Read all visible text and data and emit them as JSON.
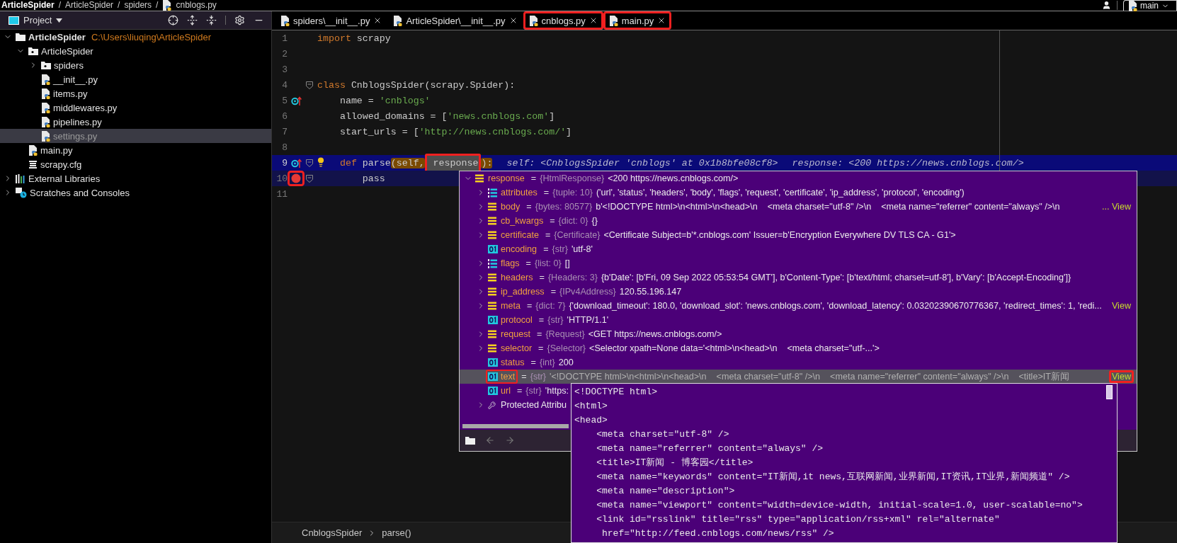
{
  "breadcrumbs": [
    {
      "kind": "item",
      "text": "ArticleSpider"
    },
    {
      "kind": "sep",
      "text": "/"
    },
    {
      "kind": "item",
      "text": "ArticleSpider"
    },
    {
      "kind": "sep",
      "text": "/"
    },
    {
      "kind": "item",
      "text": "spiders"
    },
    {
      "kind": "sep",
      "text": "/"
    },
    {
      "kind": "file",
      "text": "cnblogs.py"
    }
  ],
  "vcs": {
    "branch": "main"
  },
  "sidebar": {
    "title": "Project",
    "tree": [
      {
        "label": "ArticleSpider",
        "kind": "project",
        "path": "C:\\Users\\liuqing\\ArticleSpider",
        "expanded": true,
        "selected": false,
        "children": [
          {
            "label": "ArticleSpider",
            "kind": "package",
            "expanded": true,
            "selected": false,
            "children": [
              {
                "label": "spiders",
                "kind": "package",
                "expanded": false,
                "selected": false
              },
              {
                "label": "__init__.py",
                "kind": "python",
                "selected": false
              },
              {
                "label": "items.py",
                "kind": "python",
                "selected": false
              },
              {
                "label": "middlewares.py",
                "kind": "python",
                "selected": false
              },
              {
                "label": "pipelines.py",
                "kind": "python",
                "selected": false
              },
              {
                "label": "settings.py",
                "kind": "python",
                "selected": true
              }
            ]
          },
          {
            "label": "main.py",
            "kind": "python",
            "selected": false
          },
          {
            "label": "scrapy.cfg",
            "kind": "config",
            "selected": false
          }
        ]
      },
      {
        "label": "External Libraries",
        "kind": "libraries",
        "expanded": false,
        "selected": false
      },
      {
        "label": "Scratches and Consoles",
        "kind": "scratches",
        "expanded": false,
        "selected": false
      }
    ]
  },
  "tabs": [
    {
      "label": "spiders\\__init__.py",
      "selected": false,
      "marked": false
    },
    {
      "label": "ArticleSpider\\__init__.py",
      "selected": false,
      "marked": false
    },
    {
      "label": "cnblogs.py",
      "selected": true,
      "marked": true
    },
    {
      "label": "main.py",
      "selected": false,
      "marked": true
    }
  ],
  "editor": {
    "lines": [
      {
        "number": "1",
        "current": false,
        "breakpoint": false,
        "override": false,
        "fold": false,
        "tokens": [
          {
            "kind": "keyword",
            "text": "import"
          },
          {
            "kind": "plain",
            "text": " scrapy"
          }
        ]
      },
      {
        "number": "2",
        "current": false,
        "breakpoint": false,
        "override": false,
        "fold": false
      },
      {
        "number": "3",
        "current": false,
        "breakpoint": false,
        "override": false,
        "fold": false
      },
      {
        "number": "4",
        "current": false,
        "breakpoint": false,
        "override": false,
        "fold": true,
        "tokens": [
          {
            "kind": "keyword",
            "text": "class"
          },
          {
            "kind": "plain",
            "text": " CnblogsSpider(scrapy.Spider):"
          }
        ]
      },
      {
        "number": "5",
        "current": false,
        "breakpoint": false,
        "override": true,
        "fold": false,
        "tokens": [
          {
            "kind": "plain",
            "text": "    name = "
          },
          {
            "kind": "string",
            "text": "'cnblogs'"
          }
        ]
      },
      {
        "number": "6",
        "current": false,
        "breakpoint": false,
        "override": false,
        "fold": false,
        "tokens": [
          {
            "kind": "plain",
            "text": "    allowed_domains = ["
          },
          {
            "kind": "string",
            "text": "'news.cnblogs.com'"
          },
          {
            "kind": "plain",
            "text": "]"
          }
        ]
      },
      {
        "number": "7",
        "current": false,
        "breakpoint": false,
        "override": false,
        "fold": false,
        "tokens": [
          {
            "kind": "plain",
            "text": "    start_urls = ["
          },
          {
            "kind": "string",
            "text": "'http://news.cnblogs.com/'"
          },
          {
            "kind": "plain",
            "text": "]"
          }
        ]
      },
      {
        "number": "8",
        "current": false,
        "breakpoint": false,
        "override": false,
        "fold": false
      },
      {
        "number": "9",
        "current": true,
        "breakpoint": false,
        "override": true,
        "fold": true,
        "bulb": true,
        "tokens": [
          {
            "kind": "keyword",
            "text": "    def"
          },
          {
            "kind": "plain",
            "text": " parse"
          },
          {
            "kind": "paren",
            "text": "(self,"
          },
          {
            "kind": "param",
            "text": " response",
            "marked": true
          },
          {
            "kind": "paren",
            "text": "):"
          }
        ],
        "hints": [
          "self: <CnblogsSpider 'cnblogs' at 0x1b8bfe08cf8>",
          "response: <200 https://news.cnblogs.com/>"
        ]
      },
      {
        "number": "10",
        "current": false,
        "breakpoint": true,
        "override": false,
        "fold": true,
        "marked": true,
        "tokens": [
          {
            "kind": "plain",
            "text": "        pass"
          }
        ]
      },
      {
        "number": "11",
        "current": false,
        "breakpoint": false,
        "override": false,
        "fold": false
      }
    ],
    "footer_crumbs": [
      "CnblogsSpider",
      "parse()"
    ]
  },
  "popup": {
    "rows": [
      {
        "name": "response",
        "operator": "=",
        "type": "{HtmlResponse}",
        "value": "<200 https://news.cnblogs.com/>",
        "kind": "object",
        "expanded": true,
        "selected": false,
        "children": [
          {
            "name": "attributes",
            "operator": "=",
            "type": "{tuple: 10}",
            "value": "('url', 'status', 'headers', 'body', 'flags', 'request', 'certificate', 'ip_address', 'protocol', 'encoding')",
            "kind": "list",
            "expanded": false,
            "selected": false
          },
          {
            "name": "body",
            "operator": "=",
            "type": "{bytes: 80577}",
            "value": "b'<!DOCTYPE html>\\n<html>\\n<head>\\n    <meta charset=\"utf-8\" />\\n    <meta name=\"referrer\" content=\"always\" />\\n",
            "link": "... View",
            "kind": "object",
            "expanded": false,
            "selected": false
          },
          {
            "name": "cb_kwargs",
            "operator": "=",
            "type": "{dict: 0}",
            "value": "{}",
            "kind": "object",
            "expanded": false,
            "selected": false
          },
          {
            "name": "certificate",
            "operator": "=",
            "type": "{Certificate}",
            "value": "<Certificate Subject=b'*.cnblogs.com' Issuer=b'Encryption Everywhere DV TLS CA - G1'>",
            "kind": "object",
            "expanded": false,
            "selected": false
          },
          {
            "name": "encoding",
            "operator": "=",
            "type": "{str}",
            "value": "'utf-8'",
            "kind": "primitive",
            "selected": false
          },
          {
            "name": "flags",
            "operator": "=",
            "type": "{list: 0}",
            "value": "[]",
            "kind": "list",
            "expanded": false,
            "selected": false
          },
          {
            "name": "headers",
            "operator": "=",
            "type": "{Headers: 3}",
            "value": "{b'Date': [b'Fri, 09 Sep 2022 05:53:54 GMT'], b'Content-Type': [b'text/html; charset=utf-8'], b'Vary': [b'Accept-Encoding']}",
            "kind": "object",
            "expanded": false,
            "selected": false
          },
          {
            "name": "ip_address",
            "operator": "=",
            "type": "{IPv4Address}",
            "value": "120.55.196.147",
            "kind": "object",
            "expanded": false,
            "selected": false
          },
          {
            "name": "meta",
            "operator": "=",
            "type": "{dict: 7}",
            "value": "{'download_timeout': 180.0, 'download_slot': 'news.cnblogs.com', 'download_latency': 0.03202390670776367, 'redirect_times': 1, 'redi...",
            "link": "View",
            "kind": "object",
            "expanded": false,
            "selected": false
          },
          {
            "name": "protocol",
            "operator": "=",
            "type": "{str}",
            "value": "'HTTP/1.1'",
            "kind": "primitive",
            "selected": false
          },
          {
            "name": "request",
            "operator": "=",
            "type": "{Request}",
            "value": "<GET https://news.cnblogs.com/>",
            "kind": "object",
            "expanded": false,
            "selected": false
          },
          {
            "name": "selector",
            "operator": "=",
            "type": "{Selector}",
            "value": "<Selector xpath=None data='<html>\\n<head>\\n    <meta charset=\"utf-...'>",
            "kind": "object",
            "expanded": false,
            "selected": false
          },
          {
            "name": "status",
            "operator": "=",
            "type": "{int}",
            "value": "200",
            "kind": "primitive",
            "selected": false
          },
          {
            "name": "text",
            "operator": "=",
            "type": "{str}",
            "value": "'<!DOCTYPE html>\\n<html>\\n<head>\\n    <meta charset=\"utf-8\" />\\n    <meta name=\"referrer\" content=\"always\" />\\n    <title>IT新闻",
            "link": "View",
            "link_marked": true,
            "kind": "primitive",
            "selected": true,
            "marked": true
          },
          {
            "name": "url",
            "operator": "=",
            "type": "{str}",
            "value": "'https:",
            "kind": "primitive",
            "selected": false
          },
          {
            "name": "Protected Attribu",
            "kind": "protected",
            "expanded": false,
            "selected": false
          }
        ]
      }
    ]
  },
  "tooltip": {
    "lines": [
      "<!DOCTYPE html>",
      "<html>",
      "<head>",
      "    <meta charset=\"utf-8\" />",
      "    <meta name=\"referrer\" content=\"always\" />",
      "    <title>IT新闻 - 博客园</title>",
      "    <meta name=\"keywords\" content=\"IT新闻,it news,互联网新闻,业界新闻,IT资讯,IT业界,新闻频道\" />",
      "    <meta name=\"description\">",
      "    <meta name=\"viewport\" content=\"width=device-width, initial-scale=1.0, user-scalable=no\">",
      "    <link id=\"rsslink\" title=\"rss\" type=\"application/rss+xml\" rel=\"alternate\"",
      "     href=\"http://feed.cnblogs.com/news/rss\" />"
    ]
  }
}
